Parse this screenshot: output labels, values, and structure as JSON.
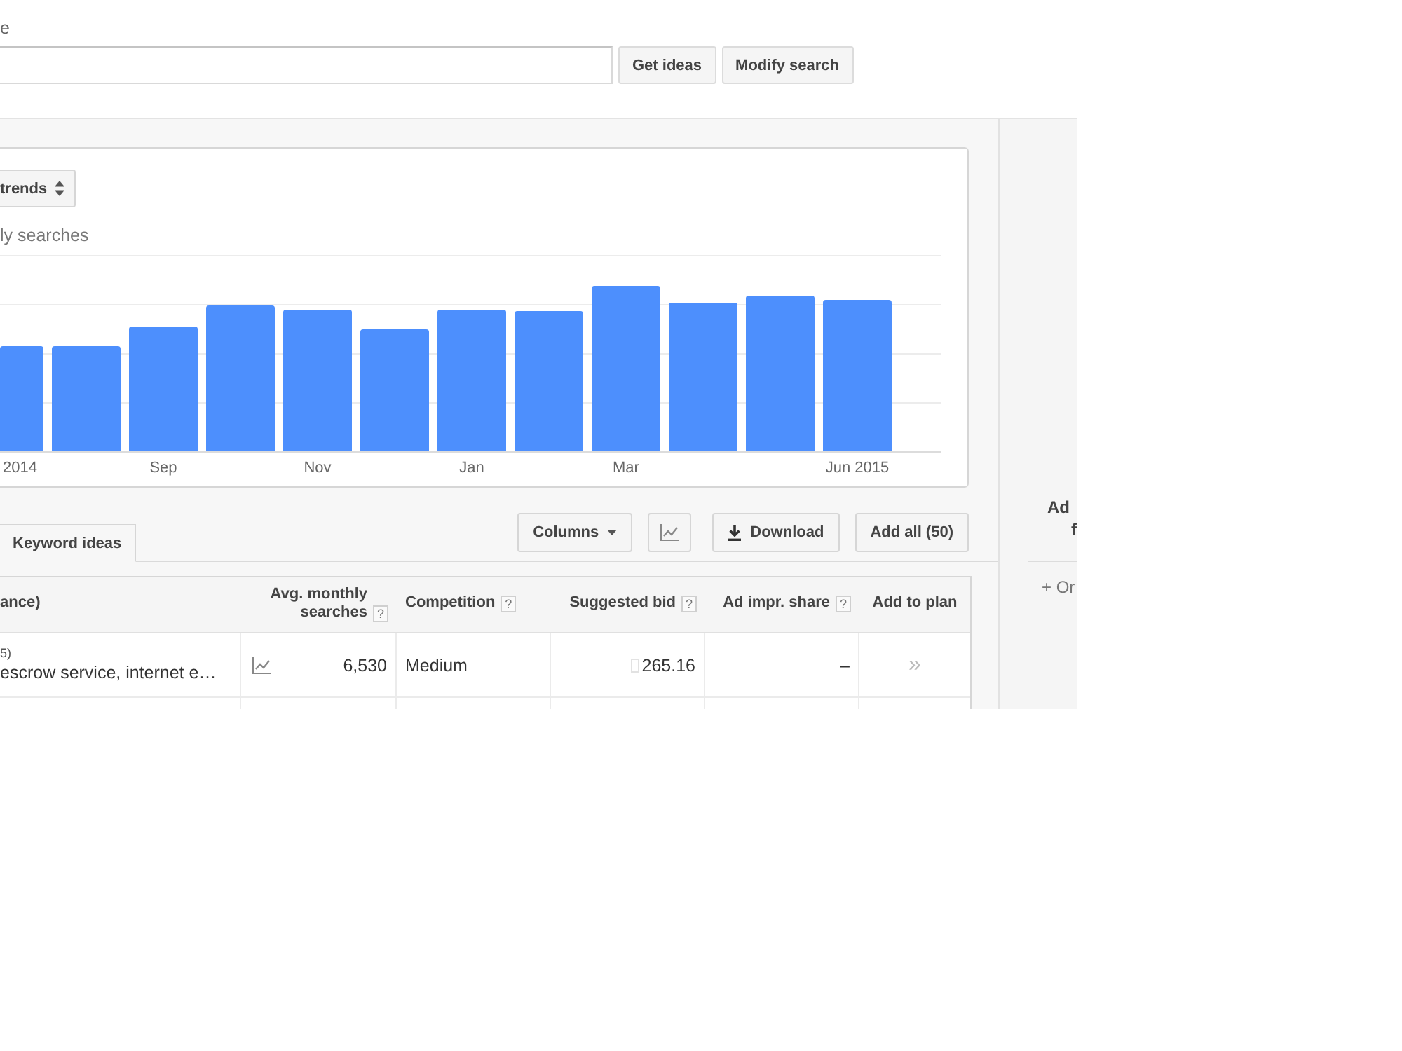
{
  "search": {
    "label": "e",
    "buttons": [
      {
        "label": "Get ideas"
      },
      {
        "label": "Modify search"
      }
    ]
  },
  "chart": {
    "metric_dropdown": {
      "label": "trends"
    },
    "title": "ly searches",
    "x_labels": [
      "2014",
      "Sep",
      "Nov",
      "Jan",
      "Mar",
      "Jun 2015"
    ]
  },
  "tabs": [
    {
      "label": "Keyword ideas",
      "selected": true
    }
  ],
  "toolbar": [
    {
      "kind": "dropdown",
      "label": "Columns"
    },
    {
      "kind": "chart"
    },
    {
      "kind": "download",
      "label": "Download"
    },
    {
      "kind": "plain",
      "label": "Add all (50)"
    }
  ],
  "table": {
    "columns": [
      {
        "label": "ance)"
      },
      {
        "label": "Avg. monthly searches",
        "help": "?"
      },
      {
        "label": "Competition",
        "help": "?"
      },
      {
        "label": "Suggested bid",
        "help": "?"
      },
      {
        "label": "Ad impr. share",
        "help": "?"
      },
      {
        "label": "Add to plan"
      }
    ],
    "rows": [
      {
        "group": "5)",
        "keywords": "escrow service, internet e…",
        "avg_monthly_searches": "6,530",
        "competition": "Medium",
        "suggested_bid": "265.16",
        "ad_impr_share": "–",
        "add_to_plan": "»"
      }
    ]
  },
  "side_panel": {
    "heading_lines": [
      "Ad",
      "f"
    ],
    "link": "+ Or"
  }
}
